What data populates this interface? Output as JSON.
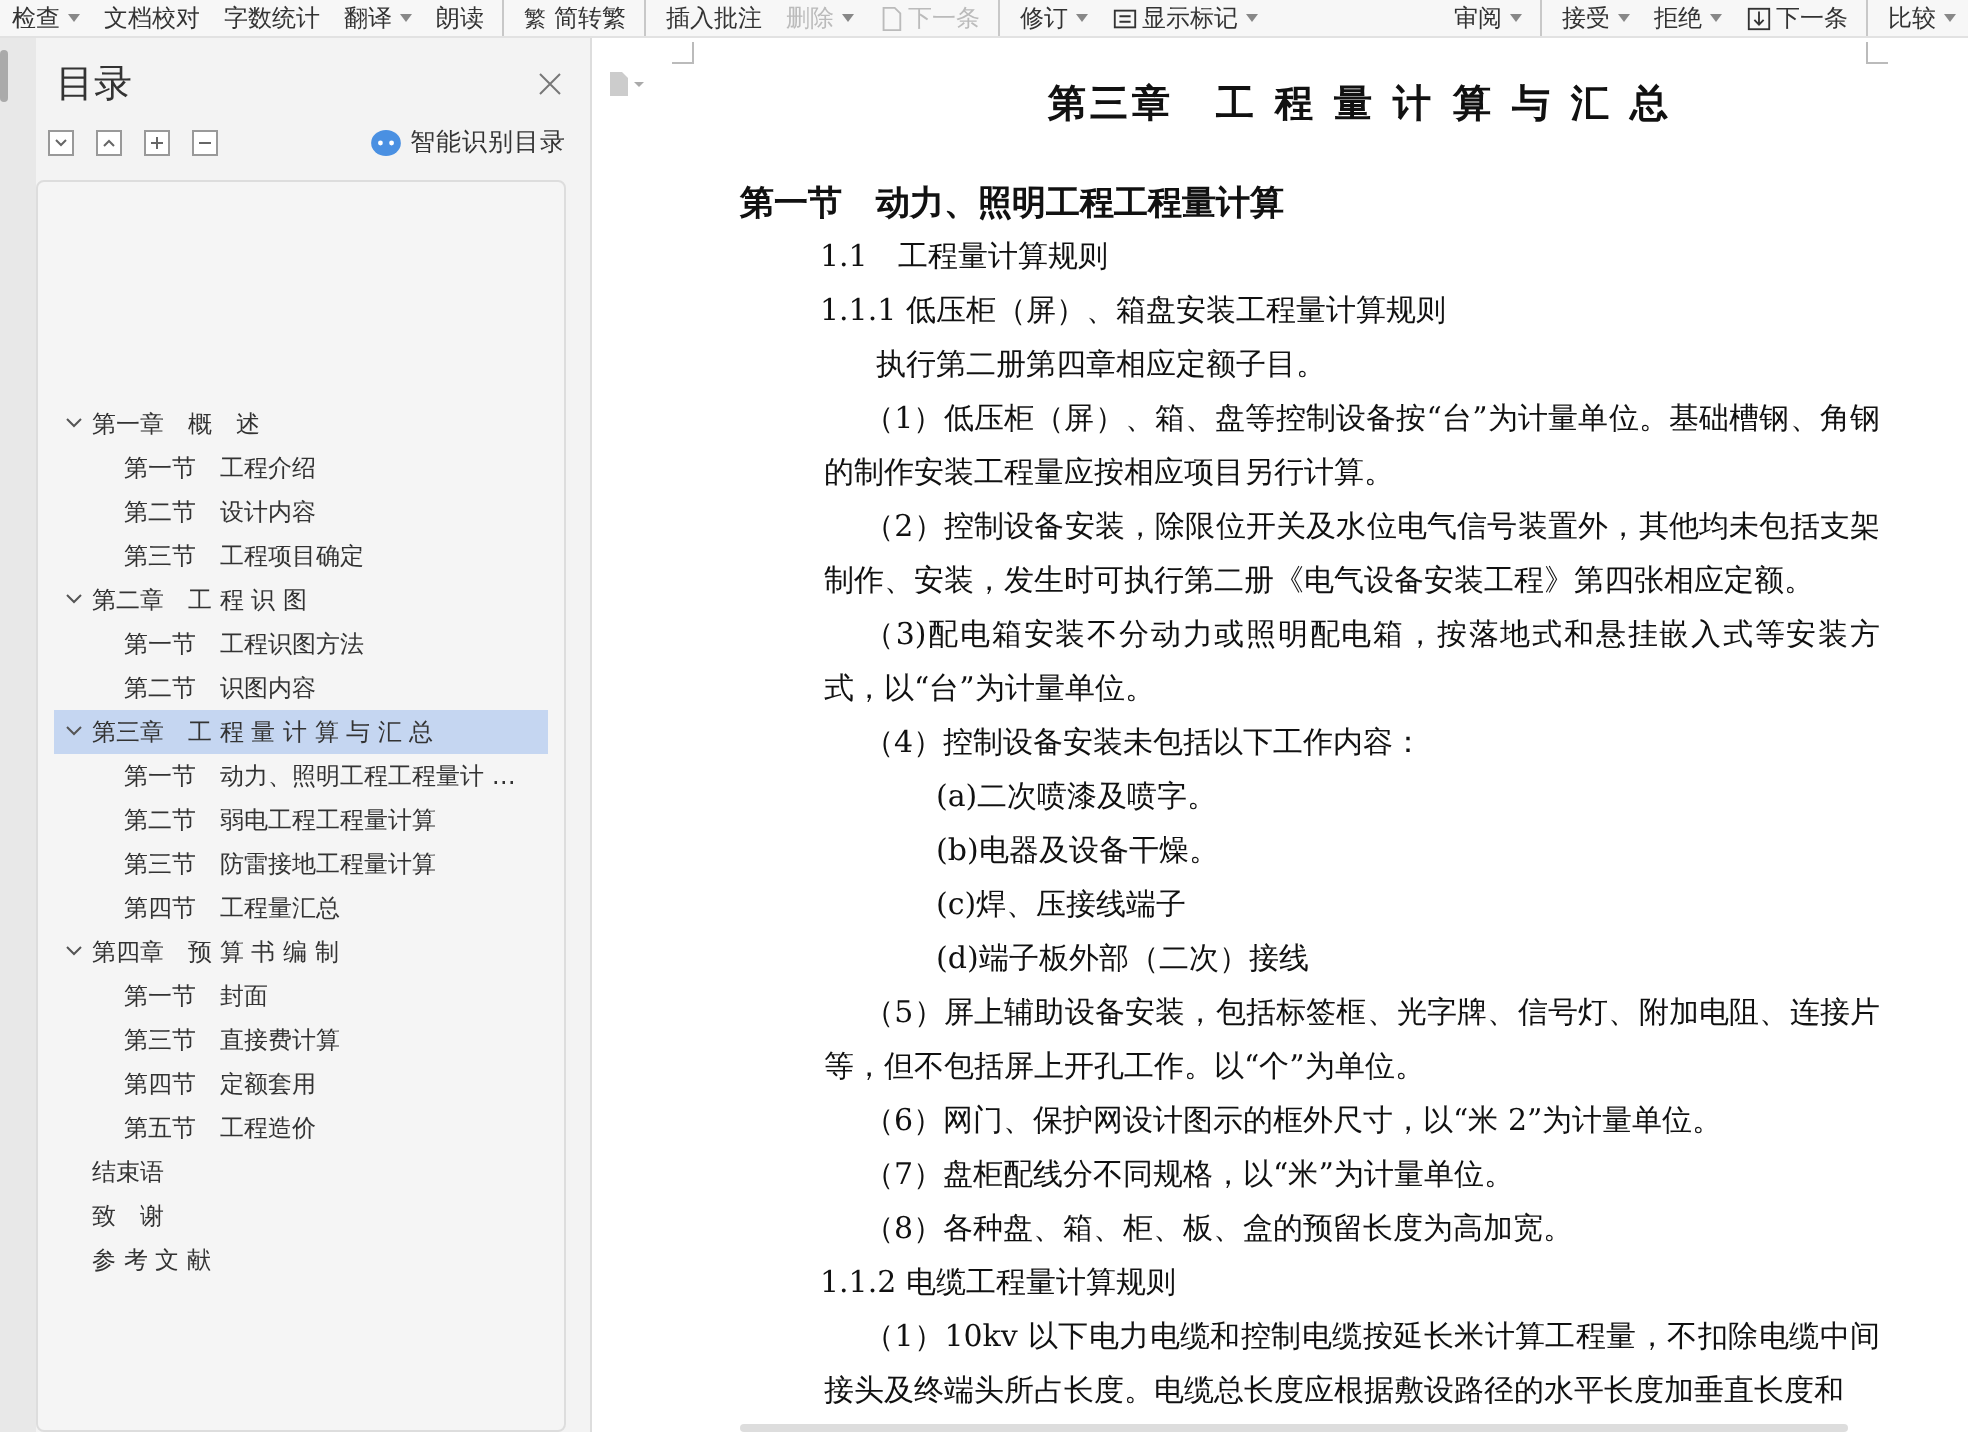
{
  "toolbar": {
    "left": [
      {
        "kind": "text",
        "label": "检查",
        "caret": true,
        "disabled": false
      },
      {
        "kind": "text",
        "label": "文档校对",
        "caret": false,
        "disabled": false
      },
      {
        "kind": "text",
        "label": "字数统计",
        "caret": false,
        "disabled": false
      },
      {
        "kind": "text",
        "label": "翻译",
        "caret": true,
        "disabled": false
      },
      {
        "kind": "text",
        "label": "朗读",
        "caret": false,
        "disabled": false,
        "separator_after": true
      },
      {
        "kind": "glyph",
        "label": "简转繁",
        "glyph": "繁",
        "caret": false,
        "disabled": false,
        "separator_after": true
      },
      {
        "kind": "text",
        "label": "插入批注",
        "caret": false,
        "disabled": false
      },
      {
        "kind": "text",
        "label": "删除",
        "caret": true,
        "disabled": true
      },
      {
        "kind": "page",
        "label": "下一条",
        "caret": false,
        "disabled": true,
        "separator_after": true
      },
      {
        "kind": "text",
        "label": "修订",
        "caret": true,
        "disabled": false
      },
      {
        "kind": "list",
        "label": "显示标记",
        "caret": true,
        "disabled": false
      }
    ],
    "right": [
      {
        "kind": "text",
        "label": "审阅",
        "caret": true,
        "disabled": false,
        "separator_after": true
      },
      {
        "kind": "text",
        "label": "接受",
        "caret": true,
        "disabled": false
      },
      {
        "kind": "text",
        "label": "拒绝",
        "caret": true,
        "disabled": false
      },
      {
        "kind": "down",
        "label": "下一条",
        "caret": false,
        "disabled": false,
        "separator_after": true
      },
      {
        "kind": "text",
        "label": "比较",
        "caret": true,
        "disabled": false
      }
    ]
  },
  "sidebar": {
    "title": "目录",
    "smart_button": "智能识别目录",
    "items": [
      {
        "label": "第一章　概　述",
        "selected": false,
        "expanded": true,
        "children": [
          {
            "label": "第一节　工程介绍",
            "selected": false
          },
          {
            "label": "第二节　设计内容",
            "selected": false
          },
          {
            "label": "第三节　工程项目确定",
            "selected": false
          }
        ]
      },
      {
        "label": "第二章　工 程 识 图",
        "selected": false,
        "expanded": true,
        "children": [
          {
            "label": "第一节　工程识图方法",
            "selected": false
          },
          {
            "label": "第二节　识图内容",
            "selected": false
          }
        ]
      },
      {
        "label": "第三章　工 程 量 计 算 与 汇 总",
        "selected": true,
        "expanded": true,
        "children": [
          {
            "label": "第一节　动力、照明工程工程量计 …",
            "selected": false
          },
          {
            "label": "第二节　弱电工程工程量计算",
            "selected": false
          },
          {
            "label": "第三节　防雷接地工程量计算",
            "selected": false
          },
          {
            "label": "第四节　工程量汇总",
            "selected": false
          }
        ]
      },
      {
        "label": "第四章　预 算 书 编 制",
        "selected": false,
        "expanded": true,
        "children": [
          {
            "label": "第一节　封面",
            "selected": false
          },
          {
            "label": "第三节　直接费计算",
            "selected": false
          },
          {
            "label": "第四节　定额套用",
            "selected": false
          },
          {
            "label": "第五节　工程造价",
            "selected": false
          }
        ]
      },
      {
        "label": "结束语",
        "selected": false
      },
      {
        "label": "致　谢",
        "selected": false
      },
      {
        "label": "参 考 文 献",
        "selected": false
      }
    ]
  },
  "document": {
    "paragraphs": [
      {
        "kind": "chapter",
        "text": "第三章　工 程 量 计 算 与 汇 总"
      },
      {
        "kind": "section",
        "text": "第一节　动力、照明工程工程量计算"
      },
      {
        "kind": "heading",
        "text": "1.1　工程量计算规则"
      },
      {
        "kind": "heading",
        "text": "1.1.1 低压柜（屏）、箱盘安装工程量计算规则"
      },
      {
        "kind": "lead",
        "text": "执行第二册第四章相应定额子目。"
      },
      {
        "kind": "para",
        "text": "（1）低压柜（屏）、箱、盘等控制设备按“台”为计量单位。基础槽钢、角钢的制作安装工程量应按相应项目另行计算。"
      },
      {
        "kind": "para",
        "text": "（2）控制设备安装，除限位开关及水位电气信号装置外，其他均未包括支架制作、安装，发生时可执行第二册《电气设备安装工程》第四张相应定额。"
      },
      {
        "kind": "para",
        "text": "（3)配电箱安装不分动力或照明配电箱，按落地式和悬挂嵌入式等安装方式，以“台”为计量单位。"
      },
      {
        "kind": "para",
        "text": "（4）控制设备安装未包括以下工作内容："
      },
      {
        "kind": "subitem",
        "text": "(a)二次喷漆及喷字。"
      },
      {
        "kind": "subitem",
        "text": "(b)电器及设备干燥。"
      },
      {
        "kind": "subitem",
        "text": "(c)焊、压接线端子"
      },
      {
        "kind": "subitem",
        "text": "(d)端子板外部（二次）接线"
      },
      {
        "kind": "para",
        "text": "（5）屏上辅助设备安装，包括标签框、光字牌、信号灯、附加电阻、连接片等，但不包括屏上开孔工作。以“个”为单位。"
      },
      {
        "kind": "para",
        "text": "（6）网门、保护网设计图示的框外尺寸，以“米 2”为计量单位。"
      },
      {
        "kind": "para",
        "text": "（7）盘柜配线分不同规格，以“米”为计量单位。"
      },
      {
        "kind": "para",
        "text": "（8）各种盘、箱、柜、板、盒的预留长度为高加宽。"
      },
      {
        "kind": "heading",
        "text": "1.1.2 电缆工程量计算规则"
      },
      {
        "kind": "para",
        "text": "（1）10kv 以下电力电缆和控制电缆按延长米计算工程量，不扣除电缆中间接头及终端头所占长度。电缆总长度应根据敷设路径的水平长度加垂直长度和"
      }
    ]
  }
}
